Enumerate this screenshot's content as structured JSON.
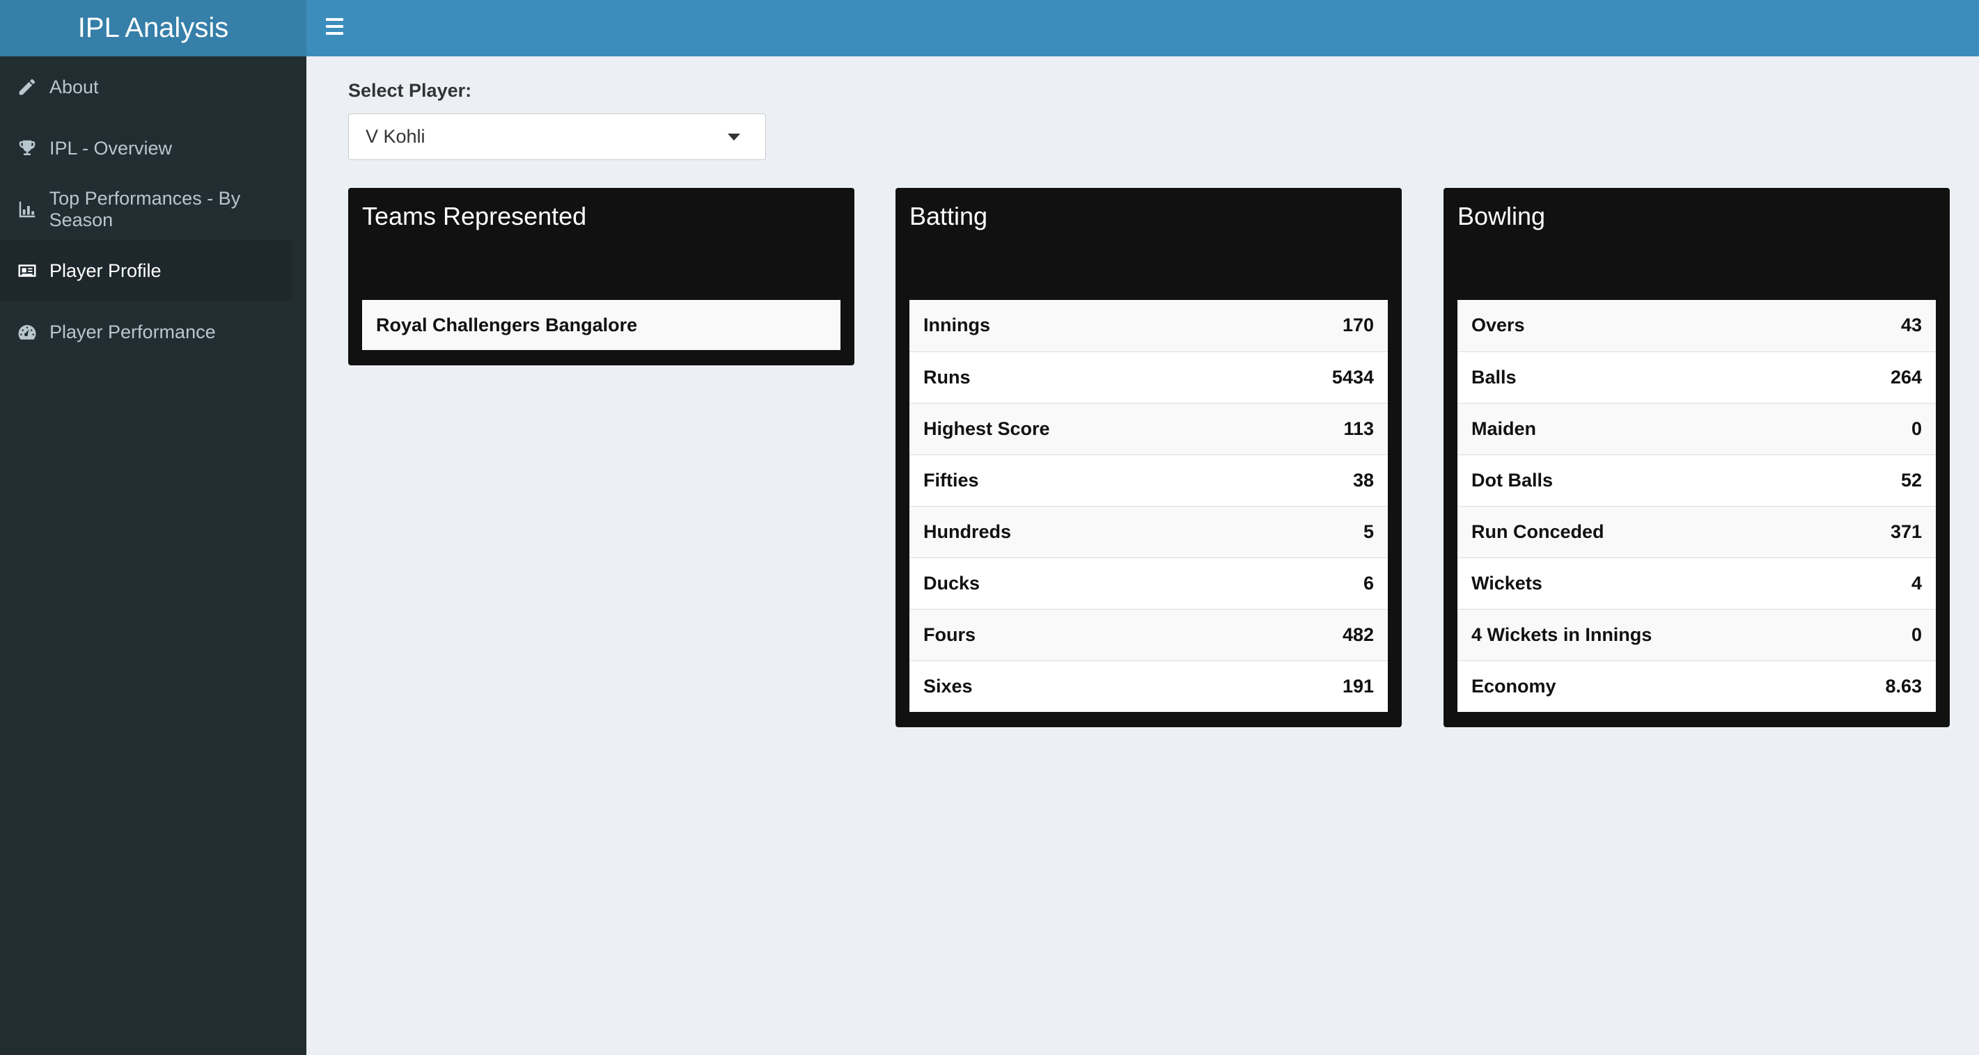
{
  "app": {
    "title": "IPL Analysis"
  },
  "sidebar": {
    "items": [
      {
        "label": "About",
        "icon": "pencil-icon",
        "active": false
      },
      {
        "label": "IPL - Overview",
        "icon": "trophy-icon",
        "active": false
      },
      {
        "label": "Top Performances - By Season",
        "icon": "bar-chart-icon",
        "active": false
      },
      {
        "label": "Player Profile",
        "icon": "id-card-icon",
        "active": true
      },
      {
        "label": "Player Performance",
        "icon": "dashboard-icon",
        "active": false
      }
    ]
  },
  "player_select": {
    "label": "Select Player:",
    "value": "V Kohli"
  },
  "teams": {
    "title": "Teams Represented",
    "items": [
      "Royal Challengers Bangalore"
    ]
  },
  "batting": {
    "title": "Batting",
    "rows": [
      {
        "label": "Innings",
        "value": "170"
      },
      {
        "label": "Runs",
        "value": "5434"
      },
      {
        "label": "Highest Score",
        "value": "113"
      },
      {
        "label": "Fifties",
        "value": "38"
      },
      {
        "label": "Hundreds",
        "value": "5"
      },
      {
        "label": "Ducks",
        "value": "6"
      },
      {
        "label": "Fours",
        "value": "482"
      },
      {
        "label": "Sixes",
        "value": "191"
      }
    ]
  },
  "bowling": {
    "title": "Bowling",
    "rows": [
      {
        "label": "Overs",
        "value": "43"
      },
      {
        "label": "Balls",
        "value": "264"
      },
      {
        "label": "Maiden",
        "value": "0"
      },
      {
        "label": "Dot Balls",
        "value": "52"
      },
      {
        "label": "Run Conceded",
        "value": "371"
      },
      {
        "label": "Wickets",
        "value": "4"
      },
      {
        "label": "4 Wickets in Innings",
        "value": "0"
      },
      {
        "label": "Economy",
        "value": "8.63"
      }
    ]
  },
  "colors": {
    "header": "#3c8dbc",
    "logo_bg": "#367fa9",
    "sidebar_bg": "#222d32",
    "box_bg": "#111111",
    "content_bg": "#ecf0f5"
  }
}
